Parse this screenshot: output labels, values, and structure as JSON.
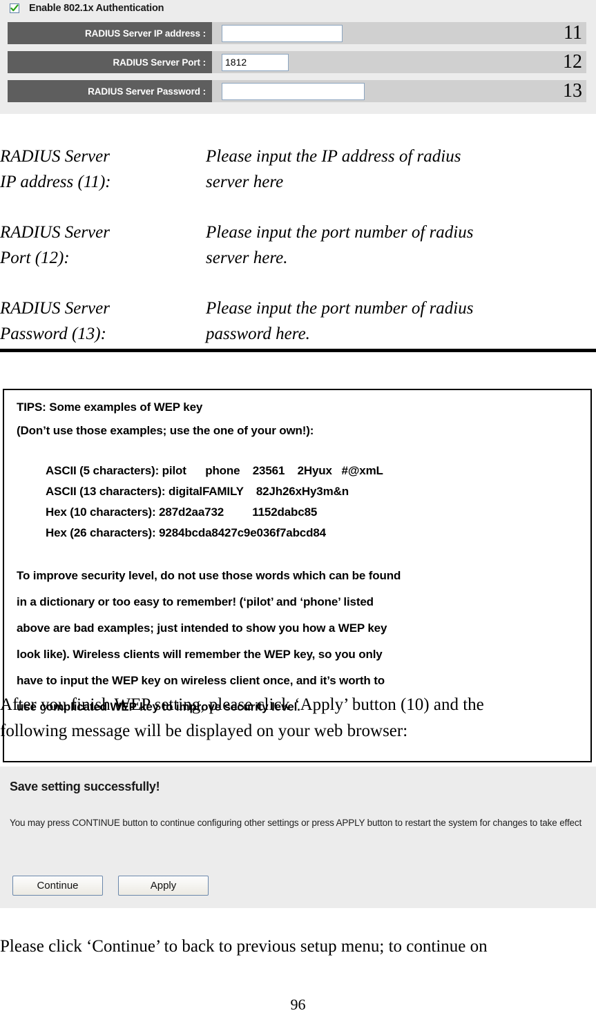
{
  "config_panel": {
    "enable_checkbox": {
      "label": "Enable 802.1x Authentication",
      "checked": true,
      "check_color": "#2aa018",
      "border_color": "#5b7fa6"
    },
    "rows": [
      {
        "label": "RADIUS Server IP address :",
        "value": "",
        "callout": "11"
      },
      {
        "label": "RADIUS Server Port :",
        "value": "1812",
        "callout": "12"
      },
      {
        "label": "RADIUS Server Password :",
        "value": "",
        "callout": "13"
      }
    ],
    "label_bg": "#5e5e5e",
    "row_bg": "#d0d0d0",
    "panel_bg": "#ececec"
  },
  "definitions": [
    {
      "term_line1": "RADIUS Server",
      "term_line2": "IP address (11):",
      "desc_line1": "Please input the IP address of radius",
      "desc_line2": "server here"
    },
    {
      "term_line1": "RADIUS Server",
      "term_line2": "Port (12):",
      "desc_line1": "Please input the port number of radius",
      "desc_line2": "server here."
    },
    {
      "term_line1": "RADIUS Server",
      "term_line2": "Password (13):",
      "desc_line1": "Please input the port number of radius",
      "desc_line2": "password here."
    }
  ],
  "tips_box": {
    "heading_line1": "TIPS: Some examples of WEP key",
    "heading_line2": "(Don’t use those examples; use the one of your own!):",
    "examples": [
      "ASCII (5 characters): pilot      phone    23561    2Hyux   #@xmL",
      "ASCII (13 characters): digitalFAMILY    82Jh26xHy3m&n",
      "Hex (10 characters): 287d2aa732         1152dabc85",
      "Hex (26 characters): 9284bcda8427c9e036f7abcd84"
    ],
    "paragraph_lines": [
      "To improve security level, do not use those words which can be found",
      "in a dictionary or too easy to remember! (‘pilot’ and ‘phone’ listed",
      "above are bad examples; just intended to show you how a WEP key",
      "look like). Wireless clients will remember the WEP key, so you only",
      "have to input the WEP key on wireless client once, and it’s worth to",
      "use complicated WEP key to improve security level."
    ]
  },
  "overlay_paragraph": {
    "lines": [
      "After you finish WEP setting, please click ‘Apply’ button (10) and the",
      "following message will be displayed on your web browser:"
    ]
  },
  "save_panel": {
    "title": "Save setting successfully!",
    "body": "You may press CONTINUE button to continue configuring other settings or press APPLY button to restart the system for changes to take effect",
    "buttons": [
      {
        "label": "Continue"
      },
      {
        "label": "Apply"
      }
    ]
  },
  "footer": {
    "paragraph": "Please click ‘Continue’ to back to previous setup menu; to continue on",
    "page_number": "96"
  }
}
